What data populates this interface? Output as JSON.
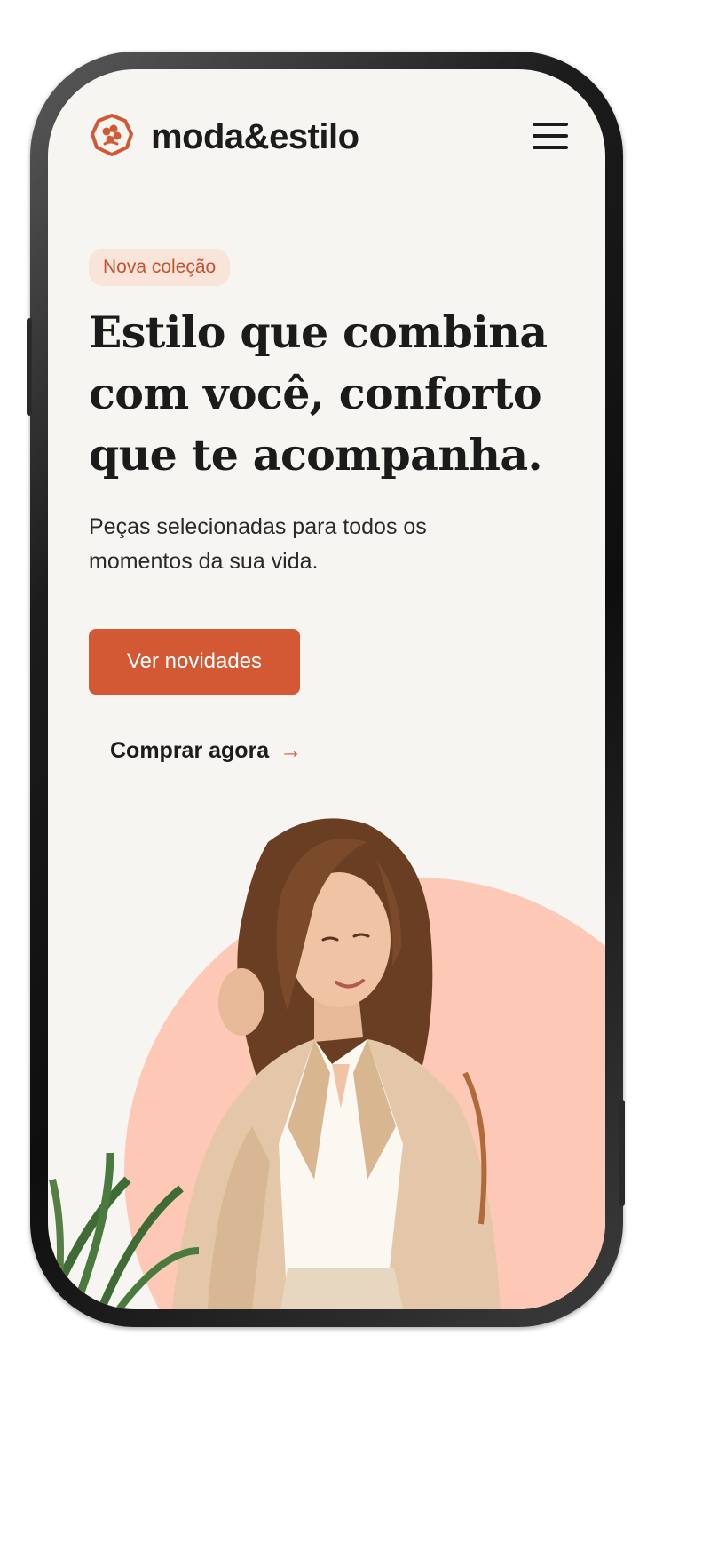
{
  "header": {
    "brand": "moda&estilo",
    "logo_icon": "flower-icon",
    "menu_icon": "hamburger-menu-icon"
  },
  "hero": {
    "badge": "Nova coleção",
    "headline": "Estilo que combina com você, conforto que te acompanha.",
    "subtitle": "Peças selecionadas para todos os momentos da sua vida.",
    "primary_cta": "Ver novidades",
    "secondary_cta": "Comprar agora",
    "secondary_cta_icon": "→",
    "image": "woman-in-beige-blazer-photo"
  },
  "colors": {
    "accent": "#d35834",
    "badge_bg": "#f9e4da",
    "circle": "#fdc9b6",
    "background": "#f7f5f2",
    "text": "#1c1c1c"
  }
}
